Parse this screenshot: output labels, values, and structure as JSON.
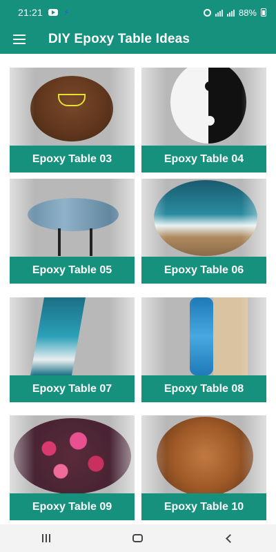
{
  "status_bar": {
    "time": "21:21",
    "battery": "88%",
    "icons": [
      "youtube-icon",
      "bolt-icon",
      "alarm-icon",
      "signal-icon",
      "signal-icon",
      "battery-icon"
    ]
  },
  "app_bar": {
    "title": "DIY Epoxy Table Ideas",
    "menu_icon": "hamburger-menu-icon"
  },
  "colors": {
    "primary": "#16917e",
    "label_text": "#ffffff",
    "nav_bar": "#f3f3f3"
  },
  "cards": [
    {
      "label": "Epoxy Table 03",
      "image": "round wooden table with coffee cup epoxy inlay"
    },
    {
      "label": "Epoxy Table 04",
      "image": "black and white yin yang resin table"
    },
    {
      "label": "Epoxy Table 05",
      "image": "blue river epoxy coffee table on metal legs"
    },
    {
      "label": "Epoxy Table 06",
      "image": "round ocean wave resin table"
    },
    {
      "label": "Epoxy Table 07",
      "image": "ocean river epoxy table top"
    },
    {
      "label": "Epoxy Table 08",
      "image": "blue river epoxy wood slab"
    },
    {
      "label": "Epoxy Table 09",
      "image": "pink orchid flowers in resin tabletop"
    },
    {
      "label": "Epoxy Table 10",
      "image": "seashells embedded in resin table"
    }
  ],
  "nav_bar": {
    "items": [
      "recents-icon",
      "home-icon",
      "back-icon"
    ]
  }
}
